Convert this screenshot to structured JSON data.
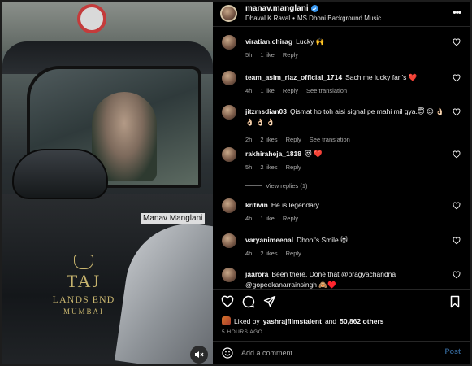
{
  "media": {
    "caption": "Manav Manglani",
    "logo_line1": "TAJ",
    "logo_line2": "LANDS END",
    "logo_line3": "MUMBAI"
  },
  "header": {
    "username": "manav.manglani",
    "audio_user": "Dhaval K Raval",
    "separator": "•",
    "audio_track": "MS Dhoni Background Music"
  },
  "comments": [
    {
      "user": "viratian.chirag",
      "text": "Lucky 🙌",
      "time": "5h",
      "likes": "1 like",
      "reply": "Reply"
    },
    {
      "user": "team_asim_riaz_official_1714",
      "text": "Sach me lucky fan's ❤️",
      "time": "4h",
      "likes": "1 like",
      "reply": "Reply",
      "translate": "See translation"
    },
    {
      "user": "jitzmsdian03",
      "text": "Qismat ho toh aisi signal pe mahi mil gya.😇 😉 👌🏻 👌🏻 👌🏻 👌🏻",
      "time": "2h",
      "likes": "2 likes",
      "reply": "Reply",
      "translate": "See translation"
    },
    {
      "user": "rakhiraheja_1818",
      "text": "😻 ❤️",
      "time": "5h",
      "likes": "2 likes",
      "reply": "Reply"
    },
    {
      "user": "kritivin",
      "text": "He is legendary",
      "time": "4h",
      "likes": "1 like",
      "reply": "Reply"
    },
    {
      "user": "varyanimeenal",
      "text": "Dhoni's Smile 😻",
      "time": "4h",
      "likes": "2 likes",
      "reply": "Reply"
    },
    {
      "user": "jaarora",
      "text": "Been there. Done that @pragyachandna @gopeekanarrainsingh 🙈♥️",
      "time": "",
      "likes": "",
      "reply": ""
    }
  ],
  "view_replies": "View replies (1)",
  "liked_by": {
    "prefix": "Liked by",
    "user": "yashrajfilmstalent",
    "middle": "and",
    "count": "50,862 others"
  },
  "time_ago": "5 HOURS AGO",
  "add_comment": {
    "placeholder": "Add a comment…",
    "post_label": "Post"
  },
  "colors": {
    "accent": "#3897f0",
    "like_red": "#ed4956",
    "muted": "#a8a8a8",
    "post_disabled": "#2f5d8a"
  }
}
